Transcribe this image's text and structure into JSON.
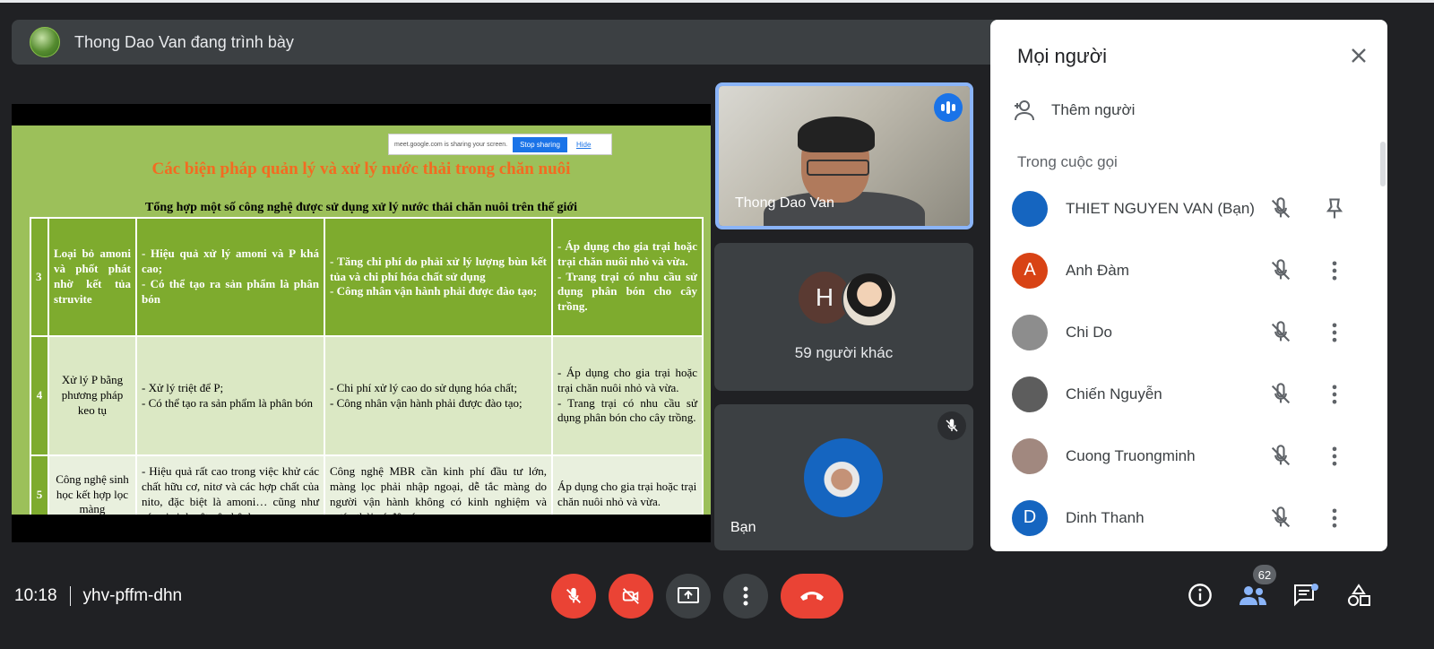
{
  "topbar": {
    "presenter_text": "Thong Dao Van đang trình bày"
  },
  "slide": {
    "share_bar": {
      "text": "meet.google.com is sharing your screen.",
      "stop": "Stop sharing",
      "hide": "Hide"
    },
    "title": "Các biện pháp quản lý và xử lý nước thải trong chăn nuôi",
    "subtitle": "Tổng hợp một số công nghệ được sử dụng xử lý nước thải chăn nuôi trên thế giới",
    "rows": [
      {
        "num": "3",
        "name": "Loại bỏ amoni và phốt phát nhờ kết tủa struvite",
        "advantages": "- Hiệu quả xử lý amoni và P khá cao;\n- Có thể tạo ra sản phẩm là phân bón",
        "disadvantages": "- Tăng chi phí do phải xử lý lượng bùn kết tủa và chi phí hóa chất sử dụng\n- Công nhân vận hành phải được đào tạo;",
        "application": "- Áp dụng cho gia trại hoặc trại chăn nuôi nhỏ và vừa.\n- Trang trại có nhu cầu sử dụng phân bón cho cây trồng."
      },
      {
        "num": "4",
        "name": "Xử lý P bằng phương pháp keo tụ",
        "advantages": "- Xử lý triệt để P;\n- Có thể tạo ra sản phẩm là phân bón",
        "disadvantages": "- Chi phí xử lý cao do sử dụng hóa chất;\n- Công nhân vận hành phải được đào tạo;",
        "application": "- Áp dụng cho gia trại hoặc trại chăn nuôi nhỏ và vừa.\n- Trang trại có nhu cầu sử dụng phân bón cho cây trồng."
      },
      {
        "num": "5",
        "name": "Công nghệ sinh học kết hợp lọc màng",
        "advantages": "- Hiệu quả rất cao trong việc khử các chất hữu cơ, nitơ và các hợp chất của nito, đặc biệt là amoni… cũng như các vi sinh vật gây bệnh.",
        "disadvantages": "Công nghệ MBR cần kinh phí đầu tư lớn, màng lọc phải nhập ngoại, dễ tắc màng do người vận hành không có kinh nghiệm và nước thải có độ cứng cao.",
        "application": "Áp dụng cho gia trại hoặc trại chăn nuôi nhỏ và vừa."
      }
    ]
  },
  "tiles": {
    "active_speaker": "Thong Dao Van",
    "others_initial": "H",
    "others_count_label": "59 người khác",
    "you_label": "Bạn"
  },
  "panel": {
    "title": "Mọi người",
    "add_people": "Thêm người",
    "section_label": "Trong cuộc gọi",
    "participants": [
      {
        "name": "THIET NGUYEN VAN (Bạn)",
        "initial": "",
        "avatar_color": "#1565c0",
        "action_icon": "pin-icon"
      },
      {
        "name": "Anh Đàm",
        "initial": "A",
        "avatar_color": "#d84315",
        "action_icon": "more-vert-icon"
      },
      {
        "name": "Chi Do",
        "initial": "",
        "avatar_color": "#8d8d8d",
        "action_icon": "more-vert-icon"
      },
      {
        "name": "Chiến Nguyễn",
        "initial": "",
        "avatar_color": "#5d5d5d",
        "action_icon": "more-vert-icon"
      },
      {
        "name": "Cuong Truongminh",
        "initial": "",
        "avatar_color": "#a1887f",
        "action_icon": "more-vert-icon"
      },
      {
        "name": "Dinh Thanh",
        "initial": "D",
        "avatar_color": "#1565c0",
        "action_icon": "more-vert-icon"
      }
    ]
  },
  "bottom": {
    "time": "10:18",
    "meeting_code": "yhv-pffm-dhn",
    "participant_count": "62"
  },
  "colors": {
    "accent_blue": "#8ab4f8",
    "danger_red": "#ea4335",
    "slide_green": "#7eab2e",
    "title_orange": "#f36b21"
  }
}
